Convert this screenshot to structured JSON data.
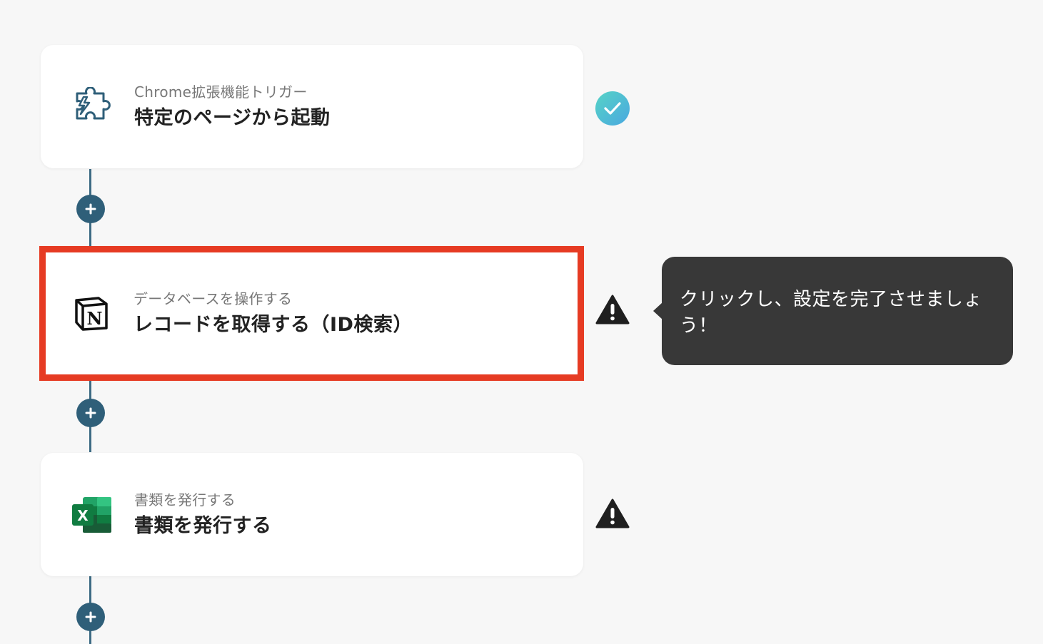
{
  "flow": {
    "steps": [
      {
        "subtitle": "Chrome拡張機能トリガー",
        "title": "特定のページから起動",
        "icon": "puzzle-piece-icon",
        "status": "complete"
      },
      {
        "subtitle": "データベースを操作する",
        "title": "レコードを取得する（ID検索）",
        "icon": "notion-logo-icon",
        "status": "warning"
      },
      {
        "subtitle": "書類を発行する",
        "title": "書類を発行する",
        "icon": "excel-logo-icon",
        "status": "warning"
      }
    ]
  },
  "tooltip": {
    "text": "クリックし、設定を完了させましょう！"
  },
  "colors": {
    "connector": "#3d6b84",
    "plus_button": "#2f5f79",
    "highlight_border": "#e63b23",
    "check_gradient_start": "#56d3c6",
    "check_gradient_end": "#4aa8e0",
    "warning": "#1f1f1f",
    "tooltip_bg": "#383838"
  }
}
